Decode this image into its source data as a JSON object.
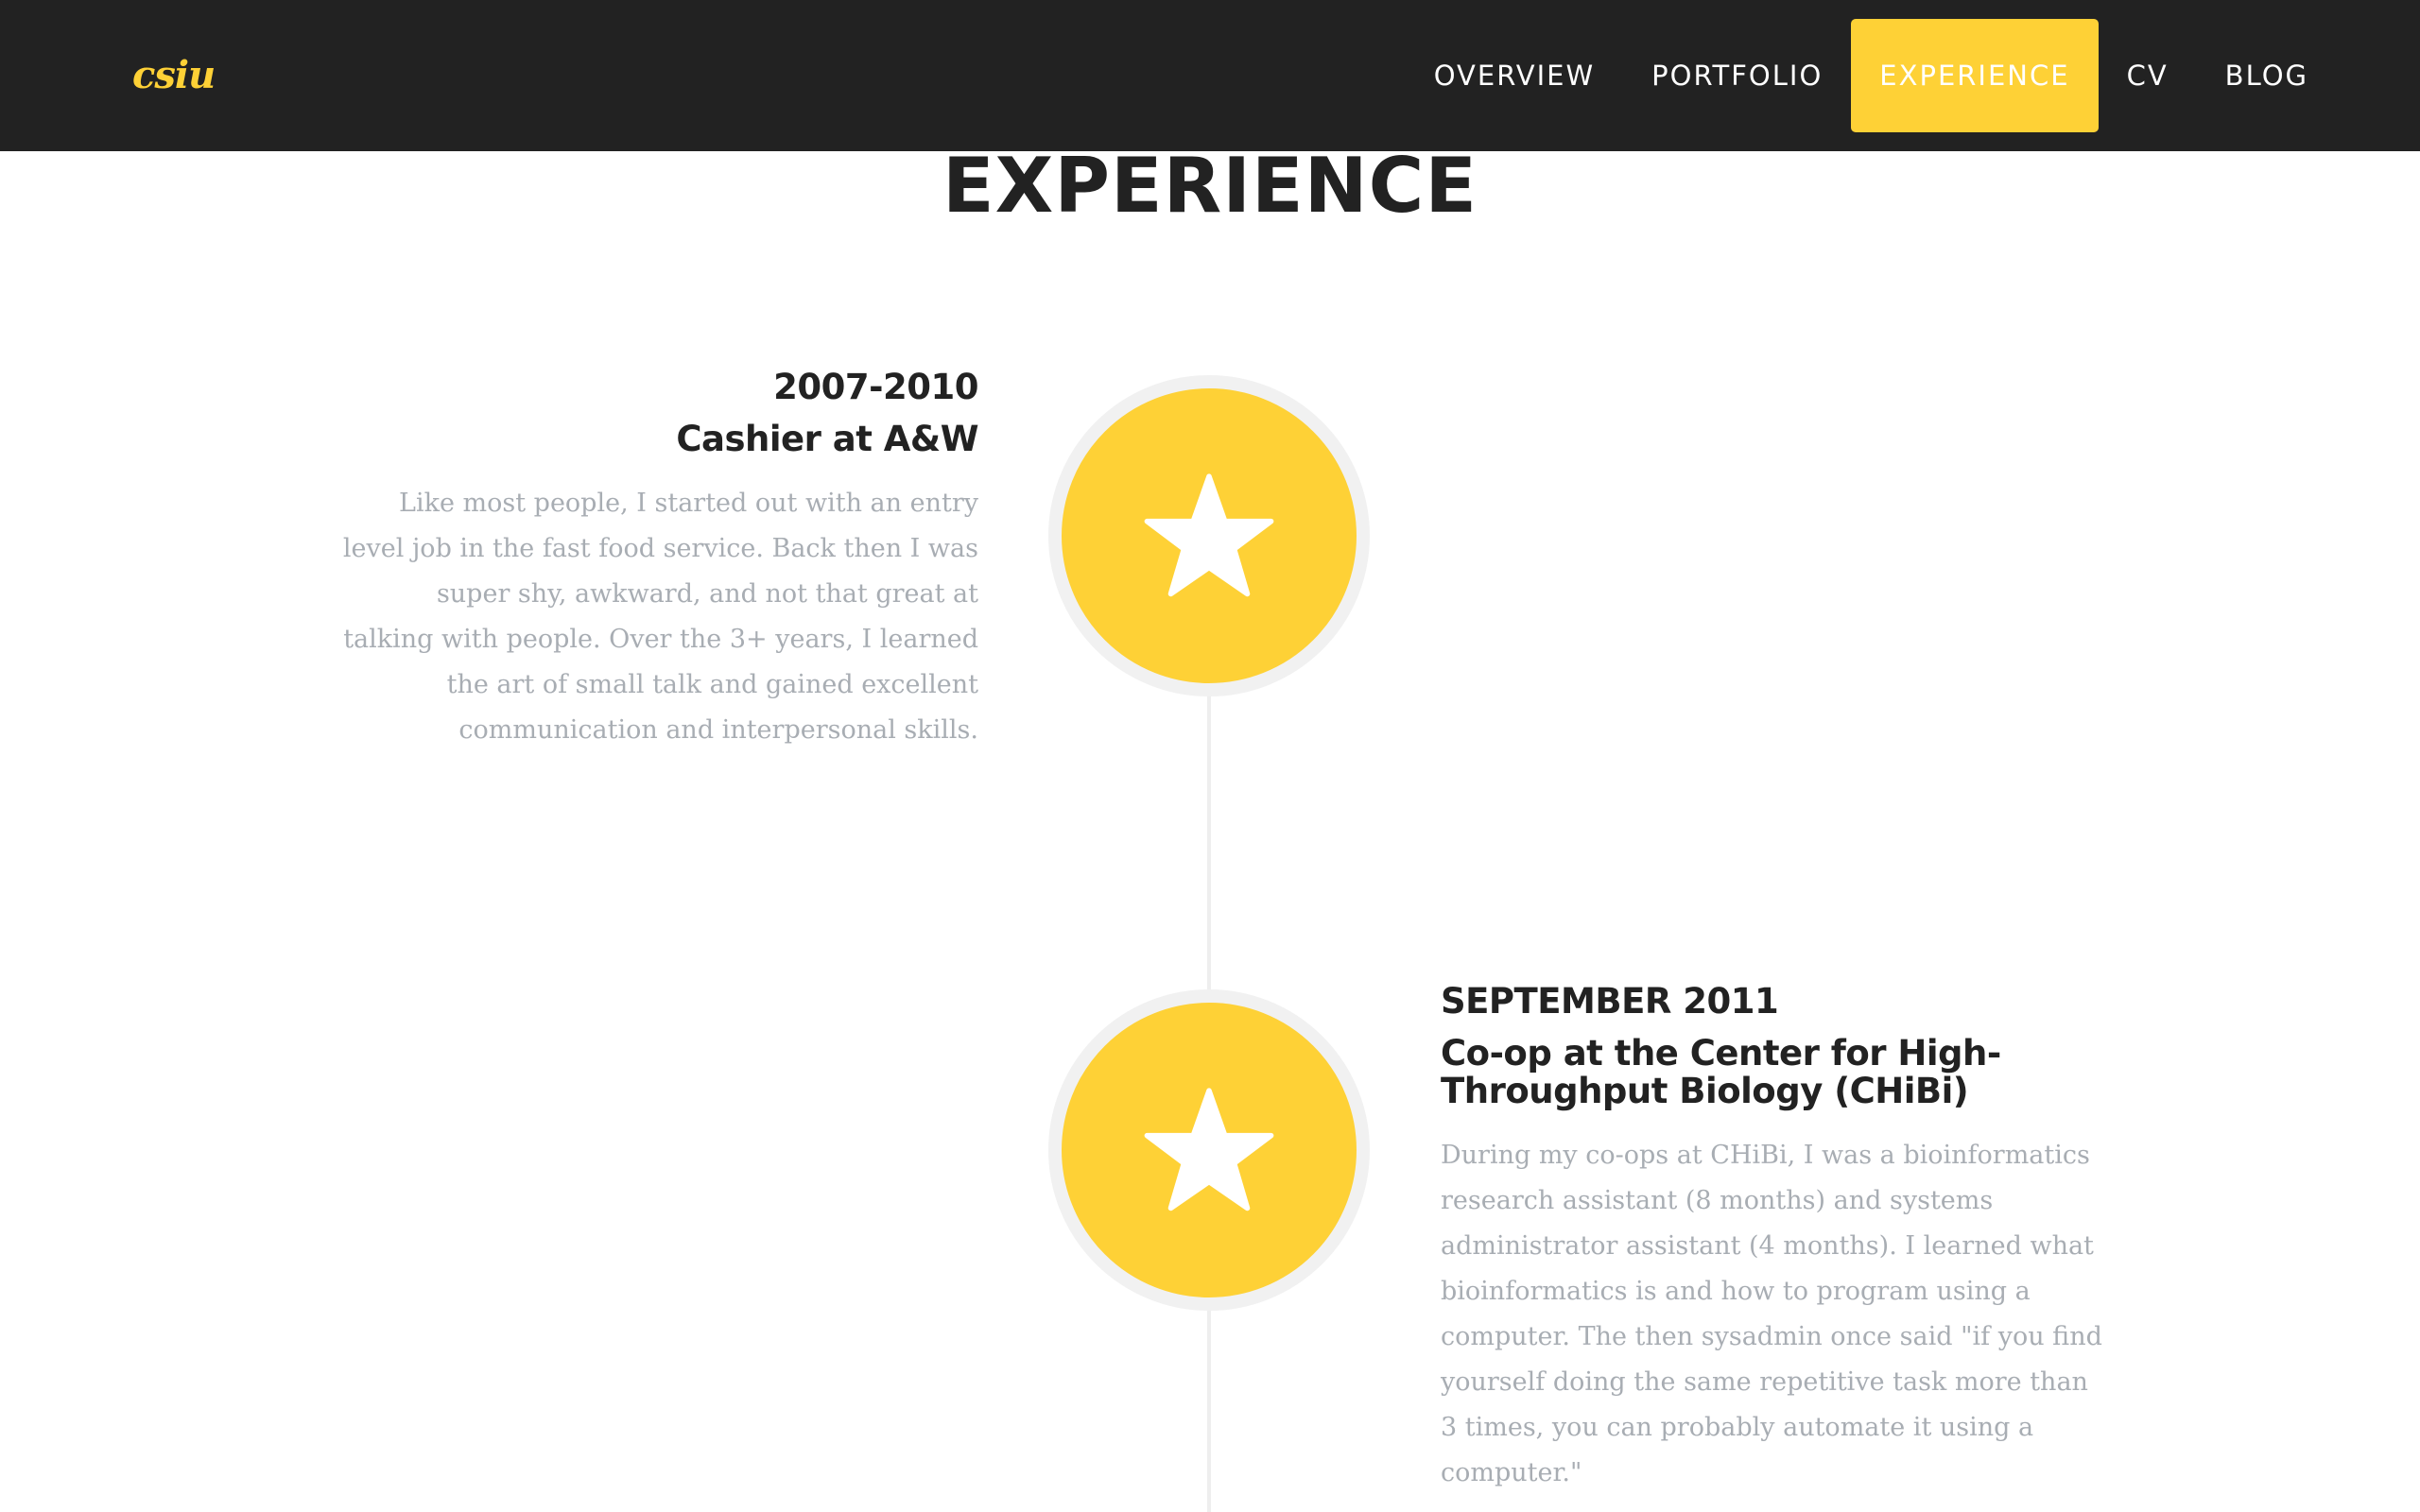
{
  "brand": "csiu",
  "nav": {
    "items": [
      {
        "label": "OVERVIEW"
      },
      {
        "label": "PORTFOLIO"
      },
      {
        "label": "EXPERIENCE"
      },
      {
        "label": "CV"
      },
      {
        "label": "BLOG"
      }
    ],
    "active": "EXPERIENCE"
  },
  "page": {
    "title": "EXPERIENCE"
  },
  "timeline": [
    {
      "date": "2007-2010",
      "title": "Cashier at A&W",
      "body": "Like most people, I started out with an entry level job in the fast food service. Back then I was super shy, awkward, and not that great at talking with people. Over the 3+ years, I learned the art of small talk and gained excellent communication and interpersonal skills.",
      "icon": "star-icon",
      "side": "left"
    },
    {
      "date": "SEPTEMBER 2011",
      "title": "Co-op at the Center for High-Throughput Biology (CHiBi)",
      "body": "During my co-ops at CHiBi, I was a bioinformatics research assistant (8 months) and systems administrator assistant (4 months). I learned what bioinformatics is and how to program using a computer. The then sysadmin once said \"if you find yourself doing the same repetitive task more than 3 times, you can probably automate it using a computer.\"",
      "icon": "star-icon",
      "side": "right"
    }
  ],
  "colors": {
    "accent": "#fed136",
    "navbar": "#222222",
    "heading": "#222222",
    "muted_text": "#a8adb3",
    "circle_border": "#f1f1f1",
    "line": "#eeeeee"
  }
}
